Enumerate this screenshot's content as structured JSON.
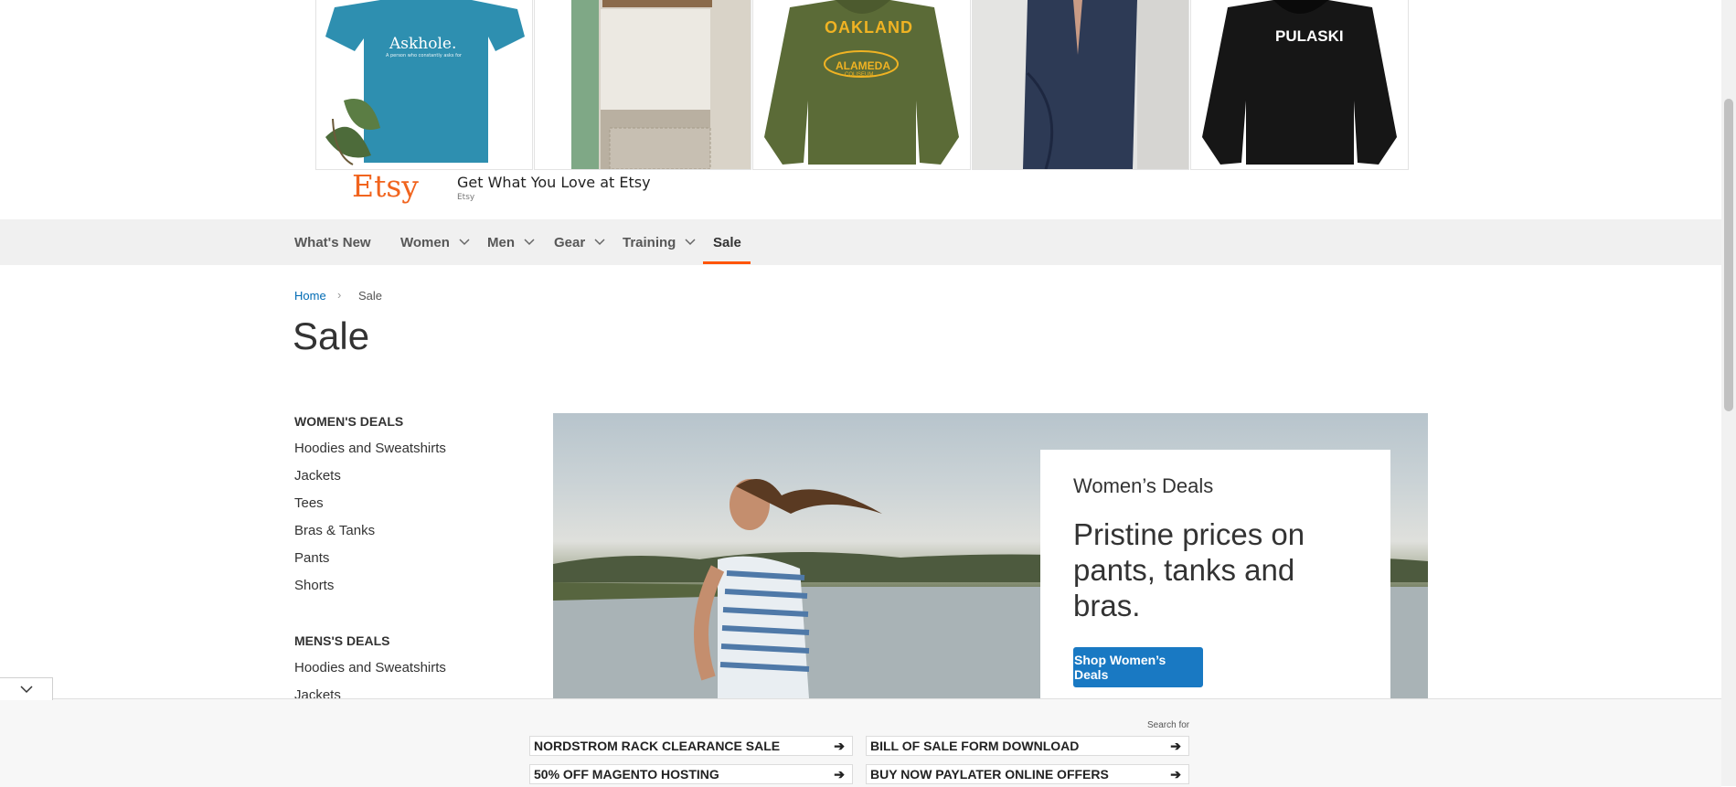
{
  "ad": {
    "brand": "Etsy",
    "title": "Get What You Love at Etsy",
    "subtitle": "Etsy",
    "tiles": [
      {
        "name": "askhole-tee",
        "text": "Askhole.",
        "small": "A person who constantly asks for"
      },
      {
        "name": "kitchen-curtain",
        "text": ""
      },
      {
        "name": "oakland-hoodie",
        "text": "OAKLAND",
        "text2": "ALAMEDA",
        "text3": "COLISEUM"
      },
      {
        "name": "robe",
        "text": ""
      },
      {
        "name": "pulaski-hoodie",
        "text": "PULASKI"
      }
    ]
  },
  "nav": {
    "items": [
      {
        "label": "What's New"
      },
      {
        "label": "Women"
      },
      {
        "label": "Men"
      },
      {
        "label": "Gear"
      },
      {
        "label": "Training"
      },
      {
        "label": "Sale"
      }
    ]
  },
  "breadcrumb": {
    "home": "Home",
    "separator": "›",
    "current": "Sale"
  },
  "page_title": "Sale",
  "sidebar": {
    "womens_heading": "WOMEN'S DEALS",
    "womens": [
      "Hoodies and Sweatshirts",
      "Jackets",
      "Tees",
      "Bras & Tanks",
      "Pants",
      "Shorts"
    ],
    "mens_heading": "MENS'S DEALS",
    "mens": [
      "Hoodies and Sweatshirts",
      "Jackets"
    ]
  },
  "hero": {
    "label": "Women’s Deals",
    "title": "Pristine prices on pants, tanks and bras.",
    "button": "Shop Women’s Deals"
  },
  "bottom_bar": {
    "search_for": "Search for",
    "links": [
      {
        "label": "NORDSTROM RACK CLEARANCE SALE",
        "arrow": "➔"
      },
      {
        "label": "BILL OF SALE FORM DOWNLOAD",
        "arrow": "➔"
      },
      {
        "label": "50% OFF MAGENTO HOSTING",
        "arrow": "➔"
      },
      {
        "label": "BUY NOW PAYLATER ONLINE OFFERS",
        "arrow": "➔"
      }
    ]
  },
  "colors": {
    "accent": "#ff5501",
    "button": "#1979c3",
    "link": "#006bb4",
    "etsy": "#f1641e"
  }
}
